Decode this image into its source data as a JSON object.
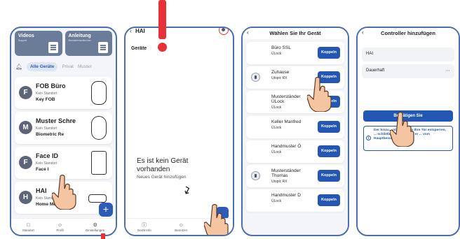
{
  "colors": {
    "accent": "#2457b3",
    "frame": "#4a6fb0",
    "alert": "#e8323a"
  },
  "phone1": {
    "cards": [
      {
        "title": "Videos",
        "subtitle": "Support"
      },
      {
        "title": "Anleitung",
        "subtitle": "Benutzerhandbücher"
      }
    ],
    "tabs": {
      "active": "Alle Geräte",
      "tab2": "Privat",
      "tab3": "Muster"
    },
    "devices": [
      {
        "letter": "F",
        "name": "FOB Büro",
        "location": "Kein Standort",
        "type": "Key FOB"
      },
      {
        "letter": "M",
        "name": "Muster Schre",
        "location": "Kein Standort",
        "type": "Biometric Re"
      },
      {
        "letter": "F",
        "name": "Face ID",
        "location": "Kein Standort",
        "type": "Face I"
      },
      {
        "letter": "H",
        "name": "HAI",
        "location": "Kein Standort",
        "type": "Home Modbus"
      }
    ],
    "fab": "+",
    "nav": {
      "standort": "Standort",
      "profil": "Profil",
      "einstellungen": "Einstellungen"
    }
  },
  "phone2": {
    "title": "HAI",
    "section": "Geräte",
    "empty_line1": "Es ist kein Gerät",
    "empty_line2": "vorhanden",
    "hint": "Neues Gerät hinzufügen",
    "nav": {
      "gerat_info": "Gerät Info",
      "benutzer": "Benutzer",
      "einstellungen": "Einstell"
    }
  },
  "phone3": {
    "title": "Wählen Sie Ihr Gerät",
    "button_label": "Koppeln",
    "devices": [
      {
        "name": "Büro SSL",
        "type": "ÜLock"
      },
      {
        "name": "Zuhause",
        "type": "Utopic RX"
      },
      {
        "name": "Musterständer\nÜLock",
        "type": "ÜLock"
      },
      {
        "name": "Keller Manfred",
        "type": "ÜLock"
      },
      {
        "name": "Handmuster Ö",
        "type": "ÜLock"
      },
      {
        "name": "Musterständer\nThomas",
        "type": "Utopic RX"
      },
      {
        "name": "Handmuster D",
        "type": "ÜLock"
      }
    ]
  },
  "phone4": {
    "title": "Controller hinzufügen",
    "name_value": "HAI",
    "duration_value": "Dauerhaft",
    "confirm_label": "Bestätigen Sie",
    "info_text": "Der hinzu... ntroller kann Ihre Tür entsperren, ... schließen, es sei denn, er ... vom Hauptbenutzer entfernt."
  }
}
